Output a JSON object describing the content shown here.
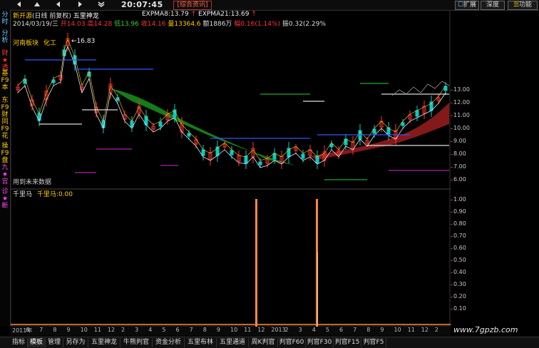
{
  "toolbar": {
    "left_icon_1": "左",
    "left_icon_2": "右",
    "left_icon_3": "下",
    "time": "20:07:45",
    "info": "[综合资讯]",
    "expand": "扩展",
    "depth": "深度",
    "functions": "功能"
  },
  "left_tabs": [
    {
      "label": "分时",
      "color": "#66ccff"
    },
    {
      "label": "分析",
      "color": "#66ccff"
    },
    {
      "label": "财★透",
      "color": "#ff3333"
    },
    {
      "label": "基F9本",
      "color": "#ffcc00"
    },
    {
      "label": "东F9财",
      "color": "#ffcc00"
    },
    {
      "label": "同F9花",
      "color": "#ffcc00"
    },
    {
      "label": "操F9盘",
      "color": "#ffcc00"
    },
    {
      "label": "九★宫",
      "color": "#ff44ff"
    },
    {
      "label": "诊★断",
      "color": "#ff44ff"
    }
  ],
  "header": {
    "stock_name": "新开源",
    "period": "(日线 前复权)",
    "indicator_name": "五里神龙",
    "expma8_label": "EXPMA8:",
    "expma8_value": "13.79",
    "expma21_label": "EXPMA21:",
    "expma21_value": "13.69",
    "date": "2014/03/19/三",
    "open_label": "开",
    "open_value": "14.03",
    "high_label": "高",
    "high_value": "14.28",
    "low_label": "低",
    "low_value": "13.96",
    "close_label": "收",
    "close_value": "14.16",
    "volume_label": "量",
    "volume_value": "13364.6",
    "amount_label": "额",
    "amount_value": "1886万",
    "change_label": "幅",
    "change_value": "0.16(1.14%)",
    "amplitude_label": "振",
    "amplitude_value": "0.32(2.29%",
    "sector": "河南板块",
    "industry": "化工",
    "peak_price": "16.83",
    "future_data_note": "用到未来数据"
  },
  "price_axis": [
    "13.00",
    "12.00",
    "11.00",
    "10.00",
    "9.00",
    "8.00",
    "7.00",
    "6.00"
  ],
  "lower_panel": {
    "name": "千里马",
    "series_label": "千里马:",
    "series_value": "0.00",
    "axis": [
      "1.00",
      "0.90",
      "0.80",
      "0.70",
      "0.60",
      "0.50",
      "0.40",
      "0.30",
      "0.20",
      "0.10"
    ]
  },
  "x_axis": [
    "2011年",
    "6",
    "7",
    "8",
    "9",
    "10",
    "11",
    "12",
    "2",
    "3",
    "4",
    "5",
    "6",
    "7",
    "8",
    "9",
    "10",
    "11",
    "12",
    "2013",
    "2",
    "3",
    "4",
    "5",
    "6",
    "7",
    "8",
    "9",
    "10",
    "11",
    "12",
    "2"
  ],
  "bottom_tabs": [
    {
      "label": "指标",
      "active": false
    },
    {
      "label": "模板",
      "active": true
    },
    {
      "label": "管理",
      "active": false
    },
    {
      "label": "另存为",
      "active": false
    },
    {
      "label": "五里神龙",
      "active": false
    },
    {
      "label": "牛熊判官",
      "active": false
    },
    {
      "label": "资金分析",
      "active": false
    },
    {
      "label": "五里布林",
      "active": false
    },
    {
      "label": "五里通道",
      "active": false
    },
    {
      "label": "周K判官",
      "active": false
    },
    {
      "label": "判官F60",
      "active": false
    },
    {
      "label": "判官F30",
      "active": false
    },
    {
      "label": "判官F15",
      "active": false
    },
    {
      "label": "判官F5",
      "active": false
    }
  ],
  "watermark": "www.7gpzb.com",
  "colors": {
    "up": "#ff3333",
    "down": "#00cccc",
    "ribbon_green": "#1a8a1a",
    "ribbon_red": "#8a1a1a",
    "signal": "#ff8844",
    "header_yellow": "#ffcc00"
  }
}
